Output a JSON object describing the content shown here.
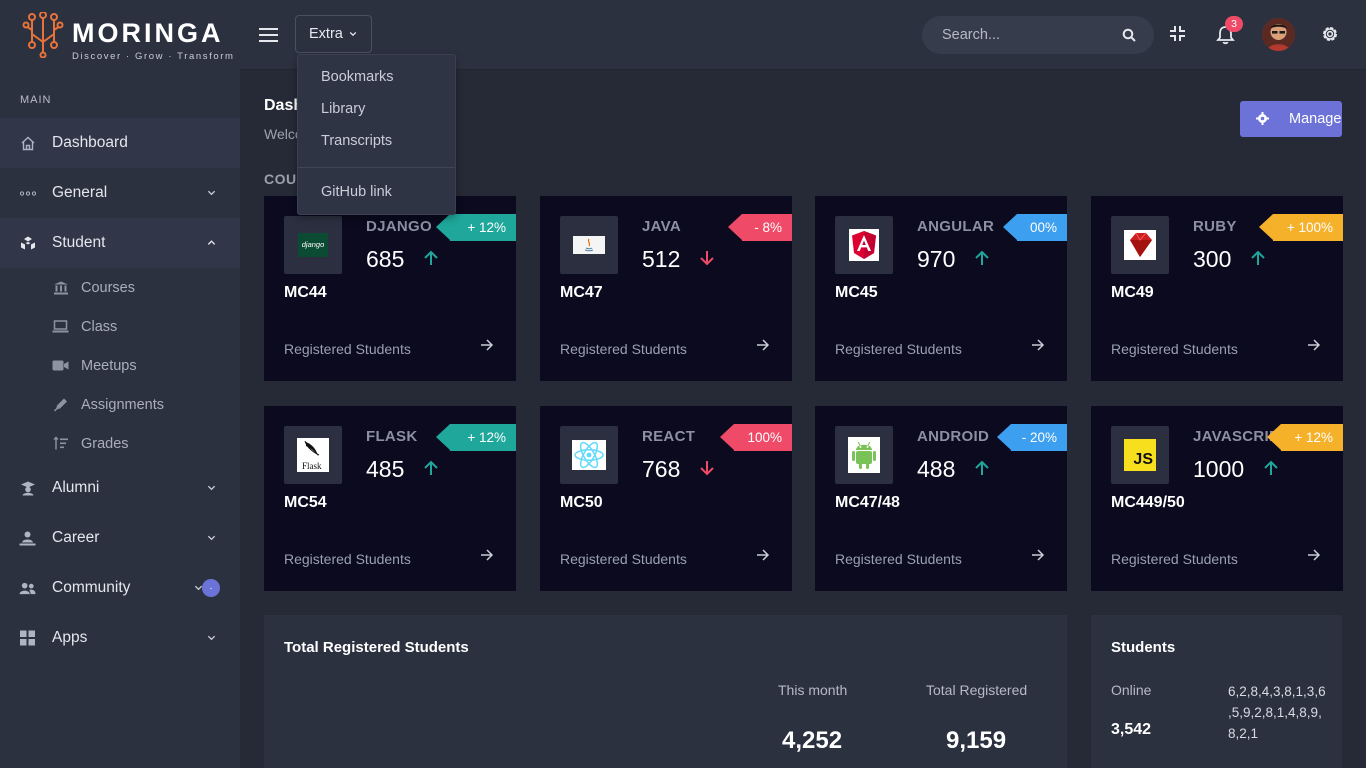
{
  "brand": {
    "name": "MORINGA",
    "tagline": "Discover · Grow · Transform"
  },
  "sidebar": {
    "section_label": "MAIN",
    "items": [
      {
        "label": "Dashboard",
        "icon": "home-icon"
      },
      {
        "label": "General",
        "icon": "dots-icon"
      },
      {
        "label": "Student",
        "icon": "cubes-icon"
      },
      {
        "label": "Alumni",
        "icon": "graduate-icon"
      },
      {
        "label": "Career",
        "icon": "career-icon"
      },
      {
        "label": "Community",
        "icon": "users-icon",
        "badge": "."
      },
      {
        "label": "Apps",
        "icon": "grid-icon"
      }
    ],
    "student_sub": [
      {
        "label": "Courses",
        "icon": "bank-icon"
      },
      {
        "label": "Class",
        "icon": "laptop-icon"
      },
      {
        "label": "Meetups",
        "icon": "video-icon"
      },
      {
        "label": "Assignments",
        "icon": "pen-icon"
      },
      {
        "label": "Grades",
        "icon": "sort-icon"
      }
    ]
  },
  "topbar": {
    "extra_label": "Extra",
    "search_placeholder": "Search...",
    "notification_count": "3"
  },
  "dropdown": {
    "items": [
      "Bookmarks",
      "Library",
      "Transcripts"
    ],
    "extra_item": "GitHub link"
  },
  "header": {
    "title": "Dashb",
    "subtitle": "Welco",
    "manage_label": "Manage",
    "section_title": "COU"
  },
  "cards": [
    {
      "name": "DJANGO",
      "count": "685",
      "trend": "up",
      "badge": "+ 12%",
      "badge_color": "#1ea79a",
      "code": "MC44",
      "footer": "Registered Students"
    },
    {
      "name": "JAVA",
      "count": "512",
      "trend": "down",
      "badge": "- 8%",
      "badge_color": "#ef4a67",
      "code": "MC47",
      "footer": "Registered Students"
    },
    {
      "name": "ANGULAR",
      "count": "970",
      "trend": "up",
      "badge": "00%",
      "badge_color": "#3d9ff0",
      "code": "MC45",
      "footer": "Registered Students"
    },
    {
      "name": "RUBY",
      "count": "300",
      "trend": "up",
      "badge": "+ 100%",
      "badge_color": "#f6b12a",
      "code": "MC49",
      "footer": "Registered Students"
    },
    {
      "name": "FLASK",
      "count": "485",
      "trend": "up",
      "badge": "+ 12%",
      "badge_color": "#1ea79a",
      "code": "MC54",
      "footer": "Registered Students"
    },
    {
      "name": "REACT",
      "count": "768",
      "trend": "down",
      "badge": "100%",
      "badge_color": "#ef4a67",
      "code": "MC50",
      "footer": "Registered Students"
    },
    {
      "name": "ANDROID",
      "count": "488",
      "trend": "up",
      "badge": "- 20%",
      "badge_color": "#3d9ff0",
      "code": "MC47/48",
      "footer": "Registered Students"
    },
    {
      "name": "JAVASCRIPT",
      "count": "1000",
      "trend": "up",
      "badge": "+ 12%",
      "badge_color": "#f6b12a",
      "code": "MC449/50",
      "footer": "Registered Students"
    }
  ],
  "total_panel": {
    "title": "Total Registered Students",
    "this_month_label": "This month",
    "this_month_value": "4,252",
    "total_label": "Total Registered",
    "total_value": "9,159"
  },
  "students_panel": {
    "title": "Students",
    "online_label": "Online",
    "online_value": "3,542",
    "sparkline_line1": "6,2,8,4,3,8,1,3,6",
    "sparkline_line2": ",5,9,2,8,1,4,8,9,",
    "sparkline_line3": "8,2,1"
  },
  "colors": {
    "accent": "#6c72d8",
    "up": "#1ea79a",
    "down": "#ef4a67",
    "card_bg": "#0b0a1e",
    "sidebar_bg": "#2c3140"
  }
}
